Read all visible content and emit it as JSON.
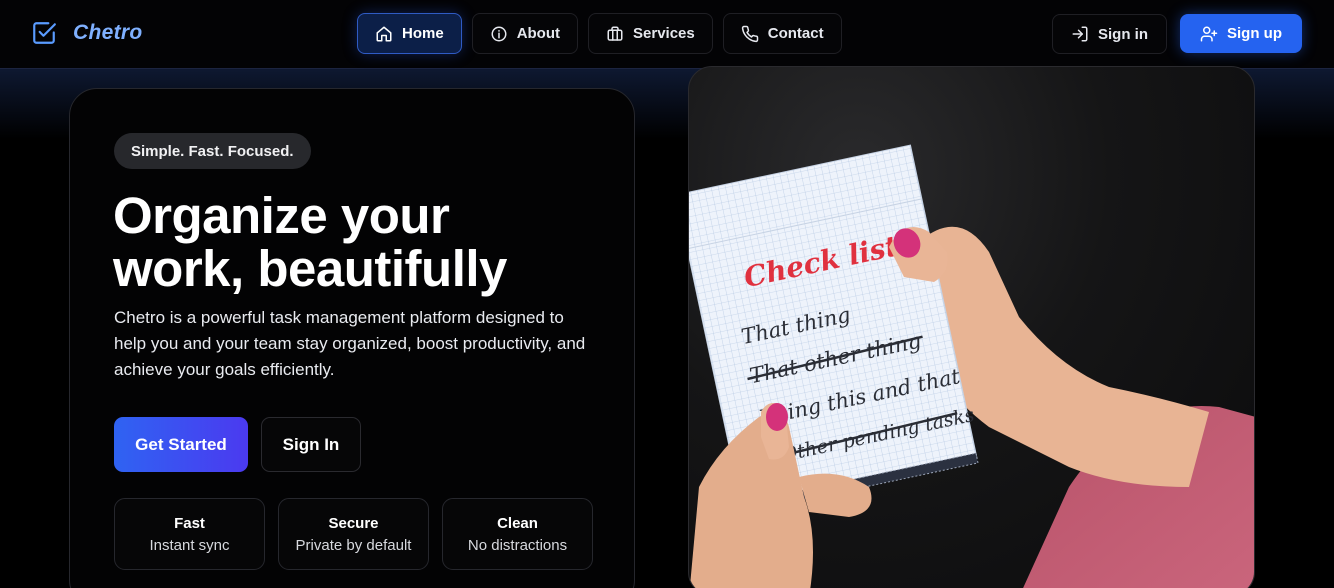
{
  "brand": {
    "name": "Chetro",
    "icon": "check-square-icon",
    "color": "#7fb0ff"
  },
  "nav": {
    "items": [
      {
        "label": "Home",
        "icon": "home-icon",
        "active": true
      },
      {
        "label": "About",
        "icon": "info-icon",
        "active": false
      },
      {
        "label": "Services",
        "icon": "briefcase-icon",
        "active": false
      },
      {
        "label": "Contact",
        "icon": "phone-icon",
        "active": false
      }
    ]
  },
  "auth": {
    "signin_label": "Sign in",
    "signin_icon": "log-in-icon",
    "signup_label": "Sign up",
    "signup_icon": "user-plus-icon"
  },
  "hero": {
    "tagline": "Simple. Fast. Focused.",
    "headline_line1": "Organize your",
    "headline_line2": "work, beautifully",
    "description": "Chetro is a powerful task management platform designed to help you and your team stay organized, boost productivity, and achieve your goals efficiently.",
    "primary_cta": "Get Started",
    "secondary_cta": "Sign In",
    "features": [
      {
        "title": "Fast",
        "subtitle": "Instant sync"
      },
      {
        "title": "Secure",
        "subtitle": "Private by default"
      },
      {
        "title": "Clean",
        "subtitle": "No distractions"
      }
    ]
  },
  "image": {
    "note_title": "Check list",
    "note_lines": [
      "That thing",
      "That other thing",
      "Doing this and that",
      "Other pending tasks"
    ]
  },
  "colors": {
    "accent": "#2563f0",
    "active_nav_bg": "#0c1f48",
    "gradient_start": "#2f63f2",
    "gradient_end": "#4b3af0",
    "note_title": "#e0313f"
  }
}
